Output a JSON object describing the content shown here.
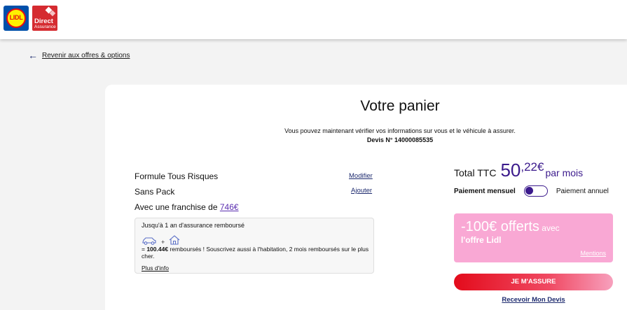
{
  "header": {
    "lidl_logo": {
      "text": "LIDL",
      "icon": "lidl-logo"
    },
    "partner_logo": {
      "text_line1": "Direct",
      "text_line2": "Assurance",
      "icon": "direct-assurance-logo"
    }
  },
  "nav": {
    "back_label": "Revenir aux offres & options",
    "back_icon": "arrow-left-icon"
  },
  "cart": {
    "title": "Votre panier",
    "subtitle": "Vous pouvez maintenant vérifier vos informations sur vous et le véhicule à assurer.",
    "devis_label": "Devis N° 14000085535"
  },
  "offer": {
    "formula": "Formule Tous Risques",
    "formula_action": "Modifier",
    "pack": "Sans Pack",
    "pack_action": "Ajouter",
    "franchise_prefix": "Avec une franchise de ",
    "franchise_amount": "746€"
  },
  "info_box": {
    "line1": "Jusqu'à 1 an d'assurance remboursé",
    "plus": "+",
    "amount": "100.44€",
    "desc_prefix": "= ",
    "desc_rest": " remboursés ! Souscrivez aussi à l'habitation, 2 mois remboursés sur le plus cher.",
    "more_link": "Plus d'info",
    "icons": [
      "car-icon",
      "house-icon"
    ]
  },
  "pricing": {
    "total_label": "Total TTC",
    "amount_int": "50",
    "amount_cents": ",22€",
    "period": "par mois",
    "monthly_label": "Paiement mensuel",
    "annual_label": "Paiement annuel",
    "toggle_state": "monthly"
  },
  "promo": {
    "headline": "-100€ offerts",
    "headline_suffix": " avec",
    "sub": "l'offre Lidl",
    "mentions": "Mentions",
    "color": "#f9a8d4"
  },
  "actions": {
    "cta_label": "JE M'ASSURE",
    "devis_link": "Recevoir Mon Devis"
  },
  "colors": {
    "accent": "#3b1a8c",
    "cta_red": "#e30b1b",
    "link_blue": "#1e2b6f"
  }
}
